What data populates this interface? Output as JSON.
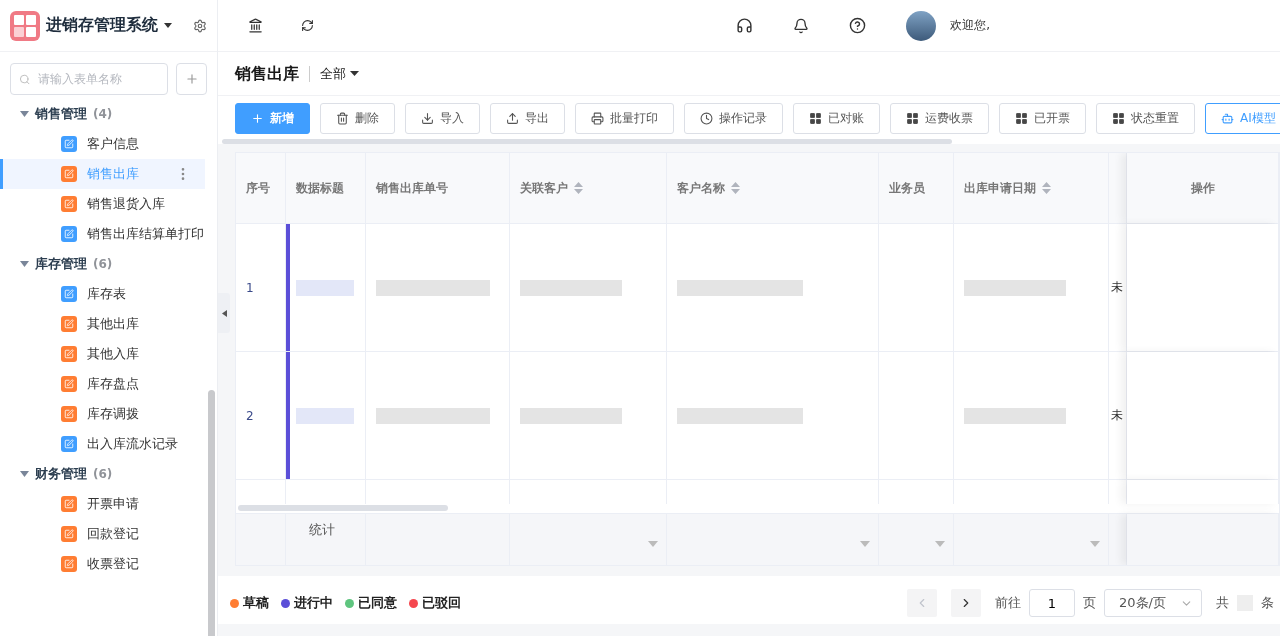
{
  "app": {
    "title": "进销存管理系统"
  },
  "sidebar": {
    "search_placeholder": "请输入表单名称",
    "groups": [
      {
        "label": "销售管理",
        "count": "(4)",
        "expanded": true,
        "children": [
          {
            "label": "客户信息",
            "color": "#409eff",
            "selected": false
          },
          {
            "label": "销售出库",
            "color": "#ff7d33",
            "selected": true
          },
          {
            "label": "销售退货入库",
            "color": "#ff7d33",
            "selected": false
          },
          {
            "label": "销售出库结算单打印",
            "color": "#409eff",
            "selected": false
          }
        ]
      },
      {
        "label": "库存管理",
        "count": "(6)",
        "expanded": true,
        "children": [
          {
            "label": "库存表",
            "color": "#409eff",
            "selected": false
          },
          {
            "label": "其他出库",
            "color": "#ff7d33",
            "selected": false
          },
          {
            "label": "其他入库",
            "color": "#ff7d33",
            "selected": false
          },
          {
            "label": "库存盘点",
            "color": "#ff7d33",
            "selected": false
          },
          {
            "label": "库存调拨",
            "color": "#ff7d33",
            "selected": false
          },
          {
            "label": "出入库流水记录",
            "color": "#409eff",
            "selected": false
          }
        ]
      },
      {
        "label": "财务管理",
        "count": "(6)",
        "expanded": true,
        "children": [
          {
            "label": "开票申请",
            "color": "#ff7d33",
            "selected": false
          },
          {
            "label": "回款登记",
            "color": "#ff7d33",
            "selected": false
          },
          {
            "label": "收票登记",
            "color": "#ff7d33",
            "selected": false
          }
        ]
      }
    ]
  },
  "topbar": {
    "welcome": "欢迎您,"
  },
  "page": {
    "title": "销售出库",
    "filter": "全部"
  },
  "toolbar": [
    {
      "label": "新增",
      "kind": "plus"
    },
    {
      "label": "删除",
      "kind": "trash"
    },
    {
      "label": "导入",
      "kind": "download"
    },
    {
      "label": "导出",
      "kind": "upload"
    },
    {
      "label": "批量打印",
      "kind": "printer"
    },
    {
      "label": "操作记录",
      "kind": "clock"
    },
    {
      "label": "已对账",
      "kind": "grid"
    },
    {
      "label": "运费收票",
      "kind": "grid"
    },
    {
      "label": "已开票",
      "kind": "grid"
    },
    {
      "label": "状态重置",
      "kind": "grid"
    },
    {
      "label": "AI模型",
      "kind": "bot"
    }
  ],
  "table": {
    "columns": [
      {
        "label": "序号",
        "sortable": false
      },
      {
        "label": "数据标题",
        "sortable": false
      },
      {
        "label": "销售出库单号",
        "sortable": false
      },
      {
        "label": "关联客户",
        "sortable": true
      },
      {
        "label": "客户名称",
        "sortable": true
      },
      {
        "label": "业务员",
        "sortable": false
      },
      {
        "label": "出库申请日期",
        "sortable": true
      },
      {
        "sortable": false
      },
      {
        "label": "操作",
        "sortable": false
      }
    ],
    "rows": [
      {
        "index": "1",
        "color": "#5b4fd8",
        "column_8": "未"
      },
      {
        "index": "2",
        "color": "#5b4fd8",
        "column_8": "未"
      }
    ],
    "summary_label": "统计"
  },
  "legend": [
    {
      "label": "草稿",
      "color": "#ff7d33"
    },
    {
      "label": "进行中",
      "color": "#5b4fd8"
    },
    {
      "label": "已同意",
      "color": "#5fc57f"
    },
    {
      "label": "已驳回",
      "color": "#f5474f"
    }
  ],
  "pagination": {
    "goto": "前往",
    "page": "1",
    "page_unit": "页",
    "page_size": "20条/页",
    "total_prefix": "共",
    "total_suffix": "条"
  }
}
